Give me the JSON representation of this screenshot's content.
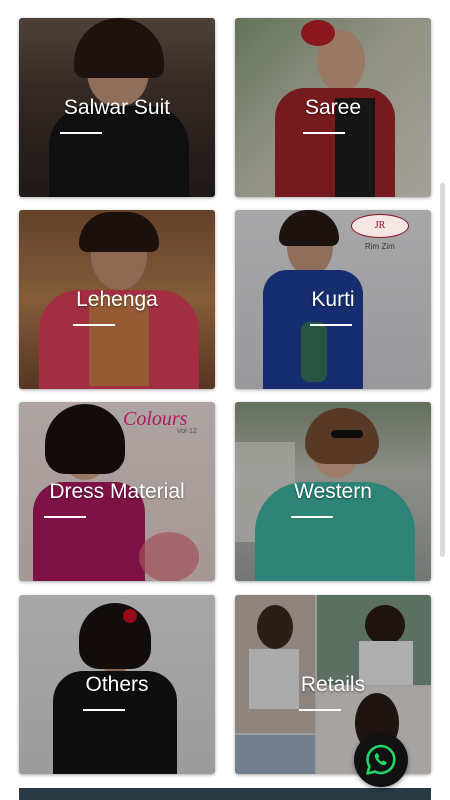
{
  "categories": [
    {
      "label": "Salwar Suit",
      "icon": "woman-in-black-suit-photo"
    },
    {
      "label": "Saree",
      "icon": "woman-in-red-saree-photo"
    },
    {
      "label": "Lehenga",
      "icon": "woman-in-pink-lehenga-photo"
    },
    {
      "label": "Kurti",
      "icon": "woman-in-blue-kurti-photo"
    },
    {
      "label": "Dress Material",
      "icon": "woman-in-magenta-dress-photo"
    },
    {
      "label": "Western",
      "icon": "woman-in-teal-top-photo"
    },
    {
      "label": "Others",
      "icon": "girl-in-black-dress-photo"
    },
    {
      "label": "Retails",
      "icon": "collage-photo"
    }
  ],
  "badges": {
    "kurti_brand": "JR",
    "kurti_brand_sub": "Rim Zim",
    "dress_brand": "Colours",
    "dress_brand_sub": "Vol-12"
  },
  "floating_button": {
    "icon": "whatsapp-icon",
    "color": "#25d366"
  },
  "colors": {
    "tile_overlay": "rgba(0,0,0,0.28)",
    "label": "#ffffff"
  }
}
